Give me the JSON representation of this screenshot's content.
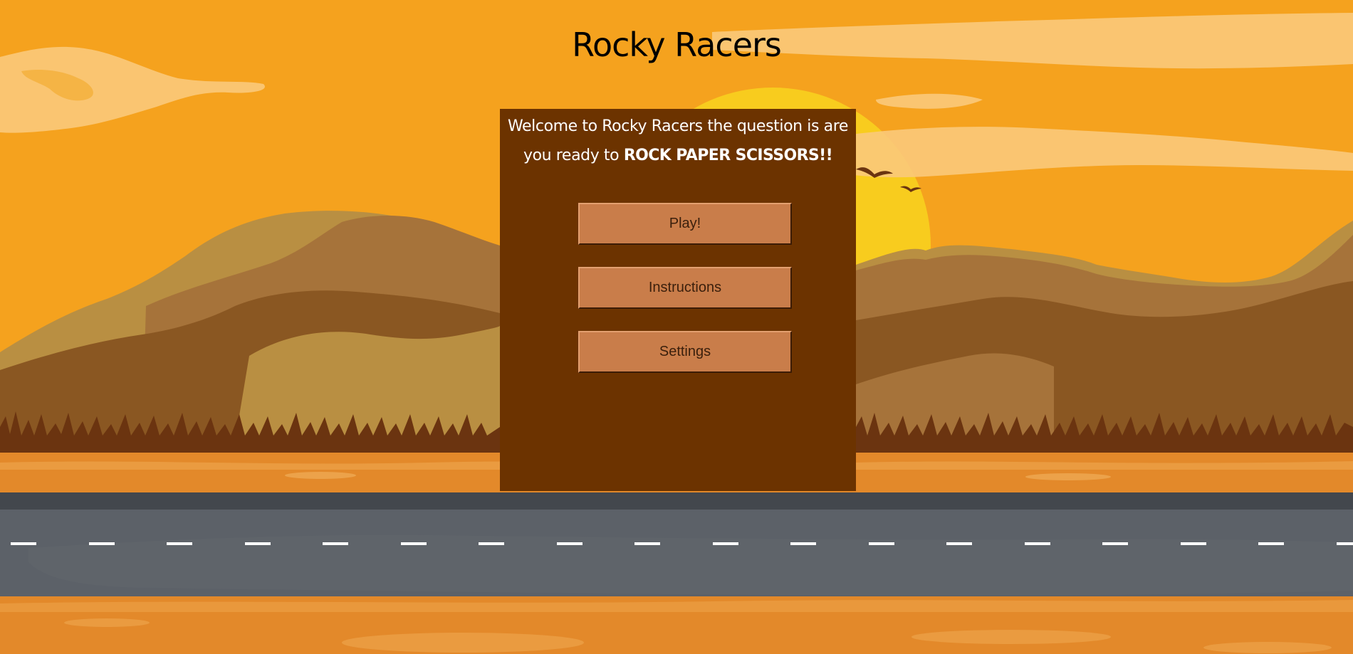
{
  "page": {
    "title": "Rocky Racers"
  },
  "welcome": {
    "text_before": "Welcome to Rocky Racers the question is are you ready to ",
    "highlight": "ROCK PAPER SCISSORS!!"
  },
  "menu": {
    "play_label": "Play!",
    "instructions_label": "Instructions",
    "settings_label": "Settings"
  },
  "colors": {
    "sky": "#f5a21e",
    "panel": "#6c3300",
    "button": "#c97d4a",
    "road": "#5c6168",
    "sun": "#f8cc1e"
  }
}
